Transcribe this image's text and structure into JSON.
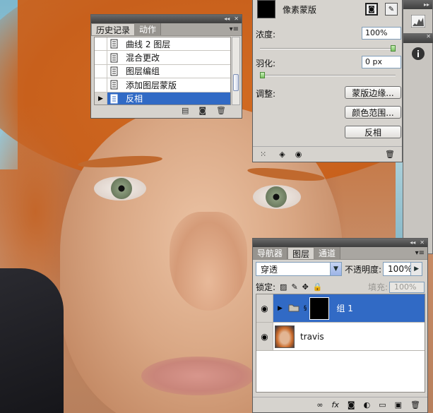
{
  "history_panel": {
    "tabs": [
      "历史记录",
      "动作"
    ],
    "items": [
      {
        "label": "曲线 2 图层",
        "selected": false
      },
      {
        "label": "混合更改",
        "selected": false
      },
      {
        "label": "图层编组",
        "selected": false
      },
      {
        "label": "添加图层蒙版",
        "selected": false
      },
      {
        "label": "反相",
        "selected": true
      }
    ]
  },
  "masks_panel": {
    "mask_type": "像素蒙版",
    "density_label": "浓度:",
    "density_value": "100%",
    "density_fraction": 1.0,
    "feather_label": "羽化:",
    "feather_value": "0 px",
    "feather_fraction": 0.0,
    "refine_label": "调整:",
    "buttons": {
      "mask_edge": "蒙版边缘...",
      "color_range": "颜色范围...",
      "invert": "反相"
    }
  },
  "layers_panel": {
    "tabs": [
      "导航器",
      "图层",
      "通道"
    ],
    "active_tab": "图层",
    "blend_mode": "穿透",
    "opacity_label": "不透明度:",
    "opacity_value": "100%",
    "lock_label": "锁定:",
    "fill_label": "填充:",
    "fill_value": "100%",
    "layers": [
      {
        "name": "组 1",
        "type": "group",
        "selected": true
      },
      {
        "name": "travis",
        "type": "image",
        "selected": false
      }
    ]
  },
  "colors": {
    "selection": "#316ac5",
    "panel": "#d6d3ce"
  }
}
